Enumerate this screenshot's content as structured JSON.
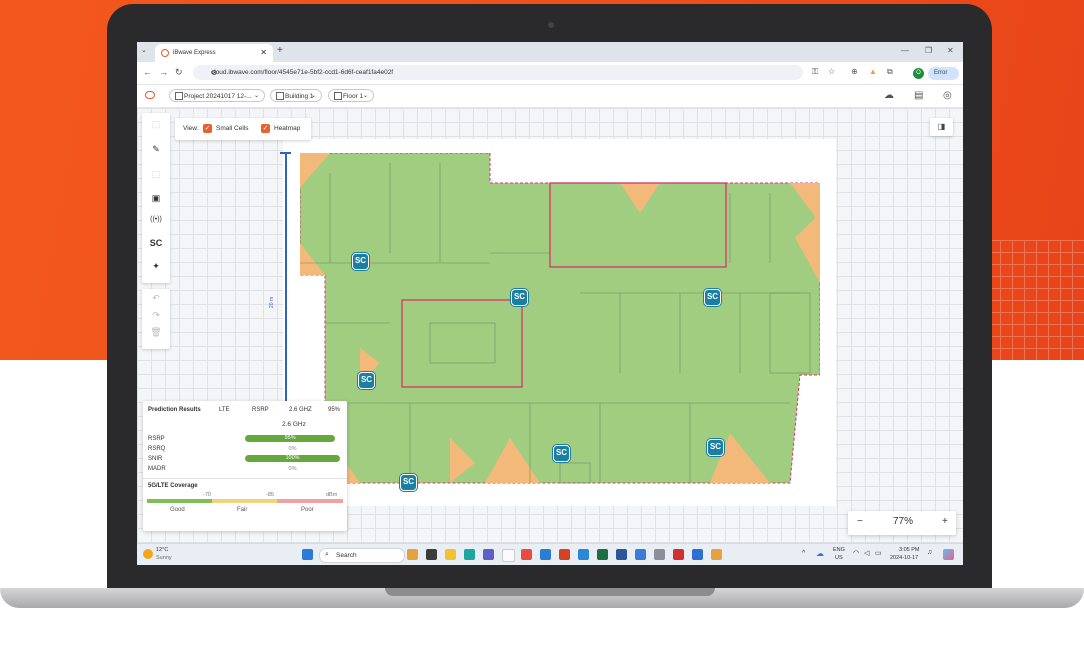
{
  "browser": {
    "tab_title": "iBwave Express",
    "url": "cloud.ibwave.com/floor/4545e71e-5bf2-ccd1-6d6f-ceaf1fa4e02f",
    "profile_initial": "O",
    "error_label": "Error"
  },
  "toolbar": {
    "project": "Project 20241017 12-...",
    "building": "Building 1",
    "floor": "Floor 1"
  },
  "view": {
    "label": "View:",
    "small_cells": "Small Cells",
    "heatmap": "Heatmap"
  },
  "ruler_label": "20 m",
  "small_cell_label": "SC",
  "prediction": {
    "title": "Prediction Results",
    "tech": "LTE",
    "metric": "RSRP",
    "band": "2.6 GHZ",
    "percent": "95%",
    "band_header": "2.6 GHz",
    "rows": [
      {
        "name": "RSRP",
        "value": "95%",
        "fraction": 0.95
      },
      {
        "name": "RSRQ",
        "value": "0%",
        "fraction": 0
      },
      {
        "name": "SNIR",
        "value": "100%",
        "fraction": 1.0
      },
      {
        "name": "MADR",
        "value": "0%",
        "fraction": 0
      }
    ],
    "coverage_title": "5G/LTE Coverage",
    "thresholds": [
      "-70",
      "-85",
      "dBm"
    ],
    "levels": [
      "Good",
      "Fair",
      "Poor"
    ],
    "colors": {
      "good": "#7fbf57",
      "fair": "#f2d27a",
      "poor": "#f0a1a1"
    }
  },
  "zoom": {
    "minus": "−",
    "value": "77%",
    "plus": "+"
  },
  "taskbar": {
    "temperature": "12°C",
    "weather": "Sunny",
    "search": "Search",
    "lang1": "ENG",
    "lang2": "US",
    "time": "3:05 PM",
    "date": "2024-10-17"
  },
  "colors": {
    "accent": "#e8602c",
    "coverage_green": "#8fc46a",
    "coverage_orange": "#f2b97a",
    "small_cell": "#1a7fa3",
    "room_outline": "#d6336c"
  }
}
